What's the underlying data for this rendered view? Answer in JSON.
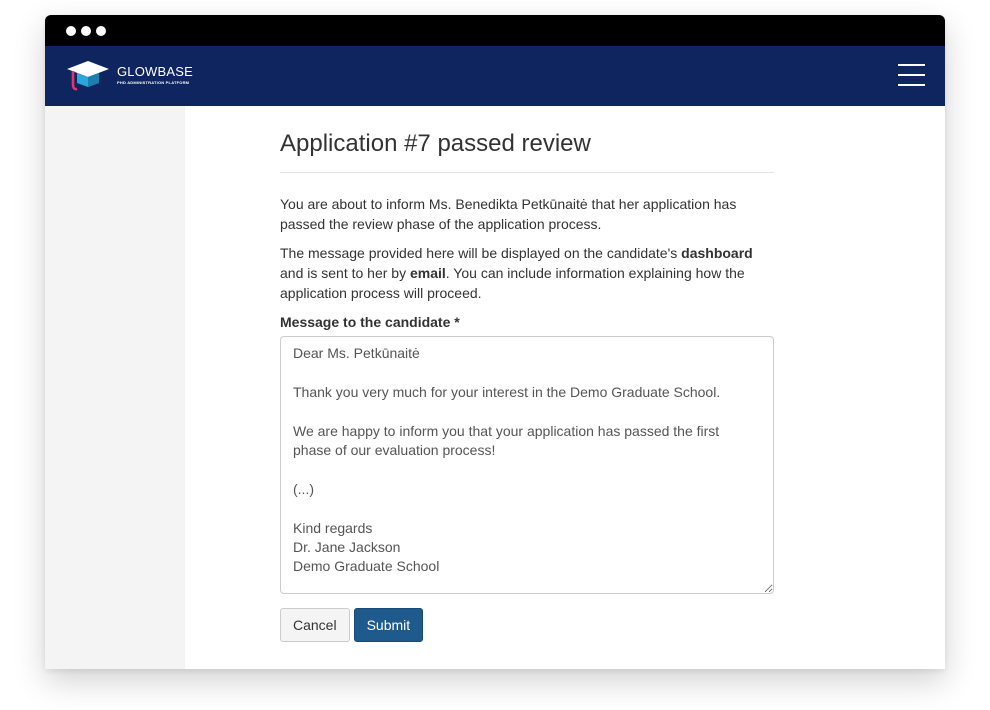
{
  "titlebar": {
    "dots": 3
  },
  "brand": {
    "name": "GLOWBASE",
    "tagline": "PHD ADMINISTRATION PLATFORM"
  },
  "page": {
    "title": "Application #7 passed review",
    "intro": "You are about to inform Ms. Benedikta Petkūnaitė that her application has passed the review phase of the application process.",
    "info_part1": "The message provided here will be displayed on the candidate's ",
    "info_bold1": "dashboard",
    "info_part2": " and is sent to her by ",
    "info_bold2": "email",
    "info_part3": ". You can include information explaining how the application process will proceed."
  },
  "form": {
    "message_label": "Message to the candidate *",
    "message_value": "Dear Ms. Petkūnaitė\n\nThank you very much for your interest in the Demo Graduate School.\n\nWe are happy to inform you that your application has passed the first phase of our evaluation process!\n\n(...)\n\nKind regards\nDr. Jane Jackson\nDemo Graduate School",
    "cancel_label": "Cancel",
    "submit_label": "Submit"
  },
  "colors": {
    "navbar": "#0f2560",
    "submit": "#1e5a8c",
    "logo_blue": "#2aa7dc",
    "logo_pink": "#e4346b"
  }
}
